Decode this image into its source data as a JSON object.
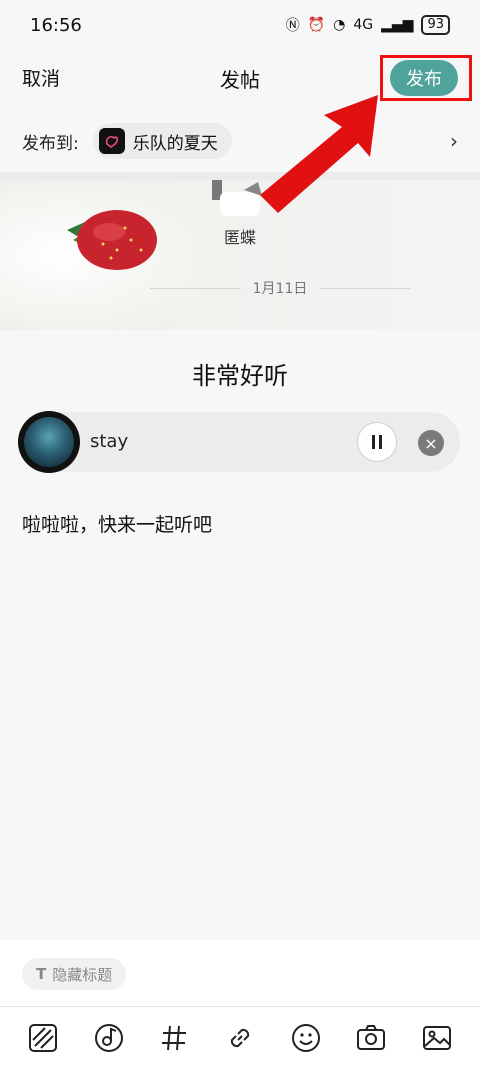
{
  "status_bar": {
    "time": "16:56",
    "network": "4G",
    "battery": "93"
  },
  "nav": {
    "cancel": "取消",
    "title": "发帖",
    "publish": "发布"
  },
  "publish_to": {
    "label": "发布到:",
    "channel": "乐队的夏天"
  },
  "post_header": {
    "author": "匿蝶",
    "date": "1月11日"
  },
  "post": {
    "title": "非常好听",
    "body": "啦啦啦，快来一起听吧"
  },
  "music": {
    "song": "stay"
  },
  "bottom": {
    "hide_title": "隐藏标题"
  },
  "colors": {
    "accent": "#4fa39a",
    "annotation_red": "#e11111"
  },
  "toolbar_icons": [
    "slash-box-icon",
    "music-note-icon",
    "hashtag-icon",
    "link-icon",
    "emoji-icon",
    "camera-icon",
    "image-icon"
  ]
}
